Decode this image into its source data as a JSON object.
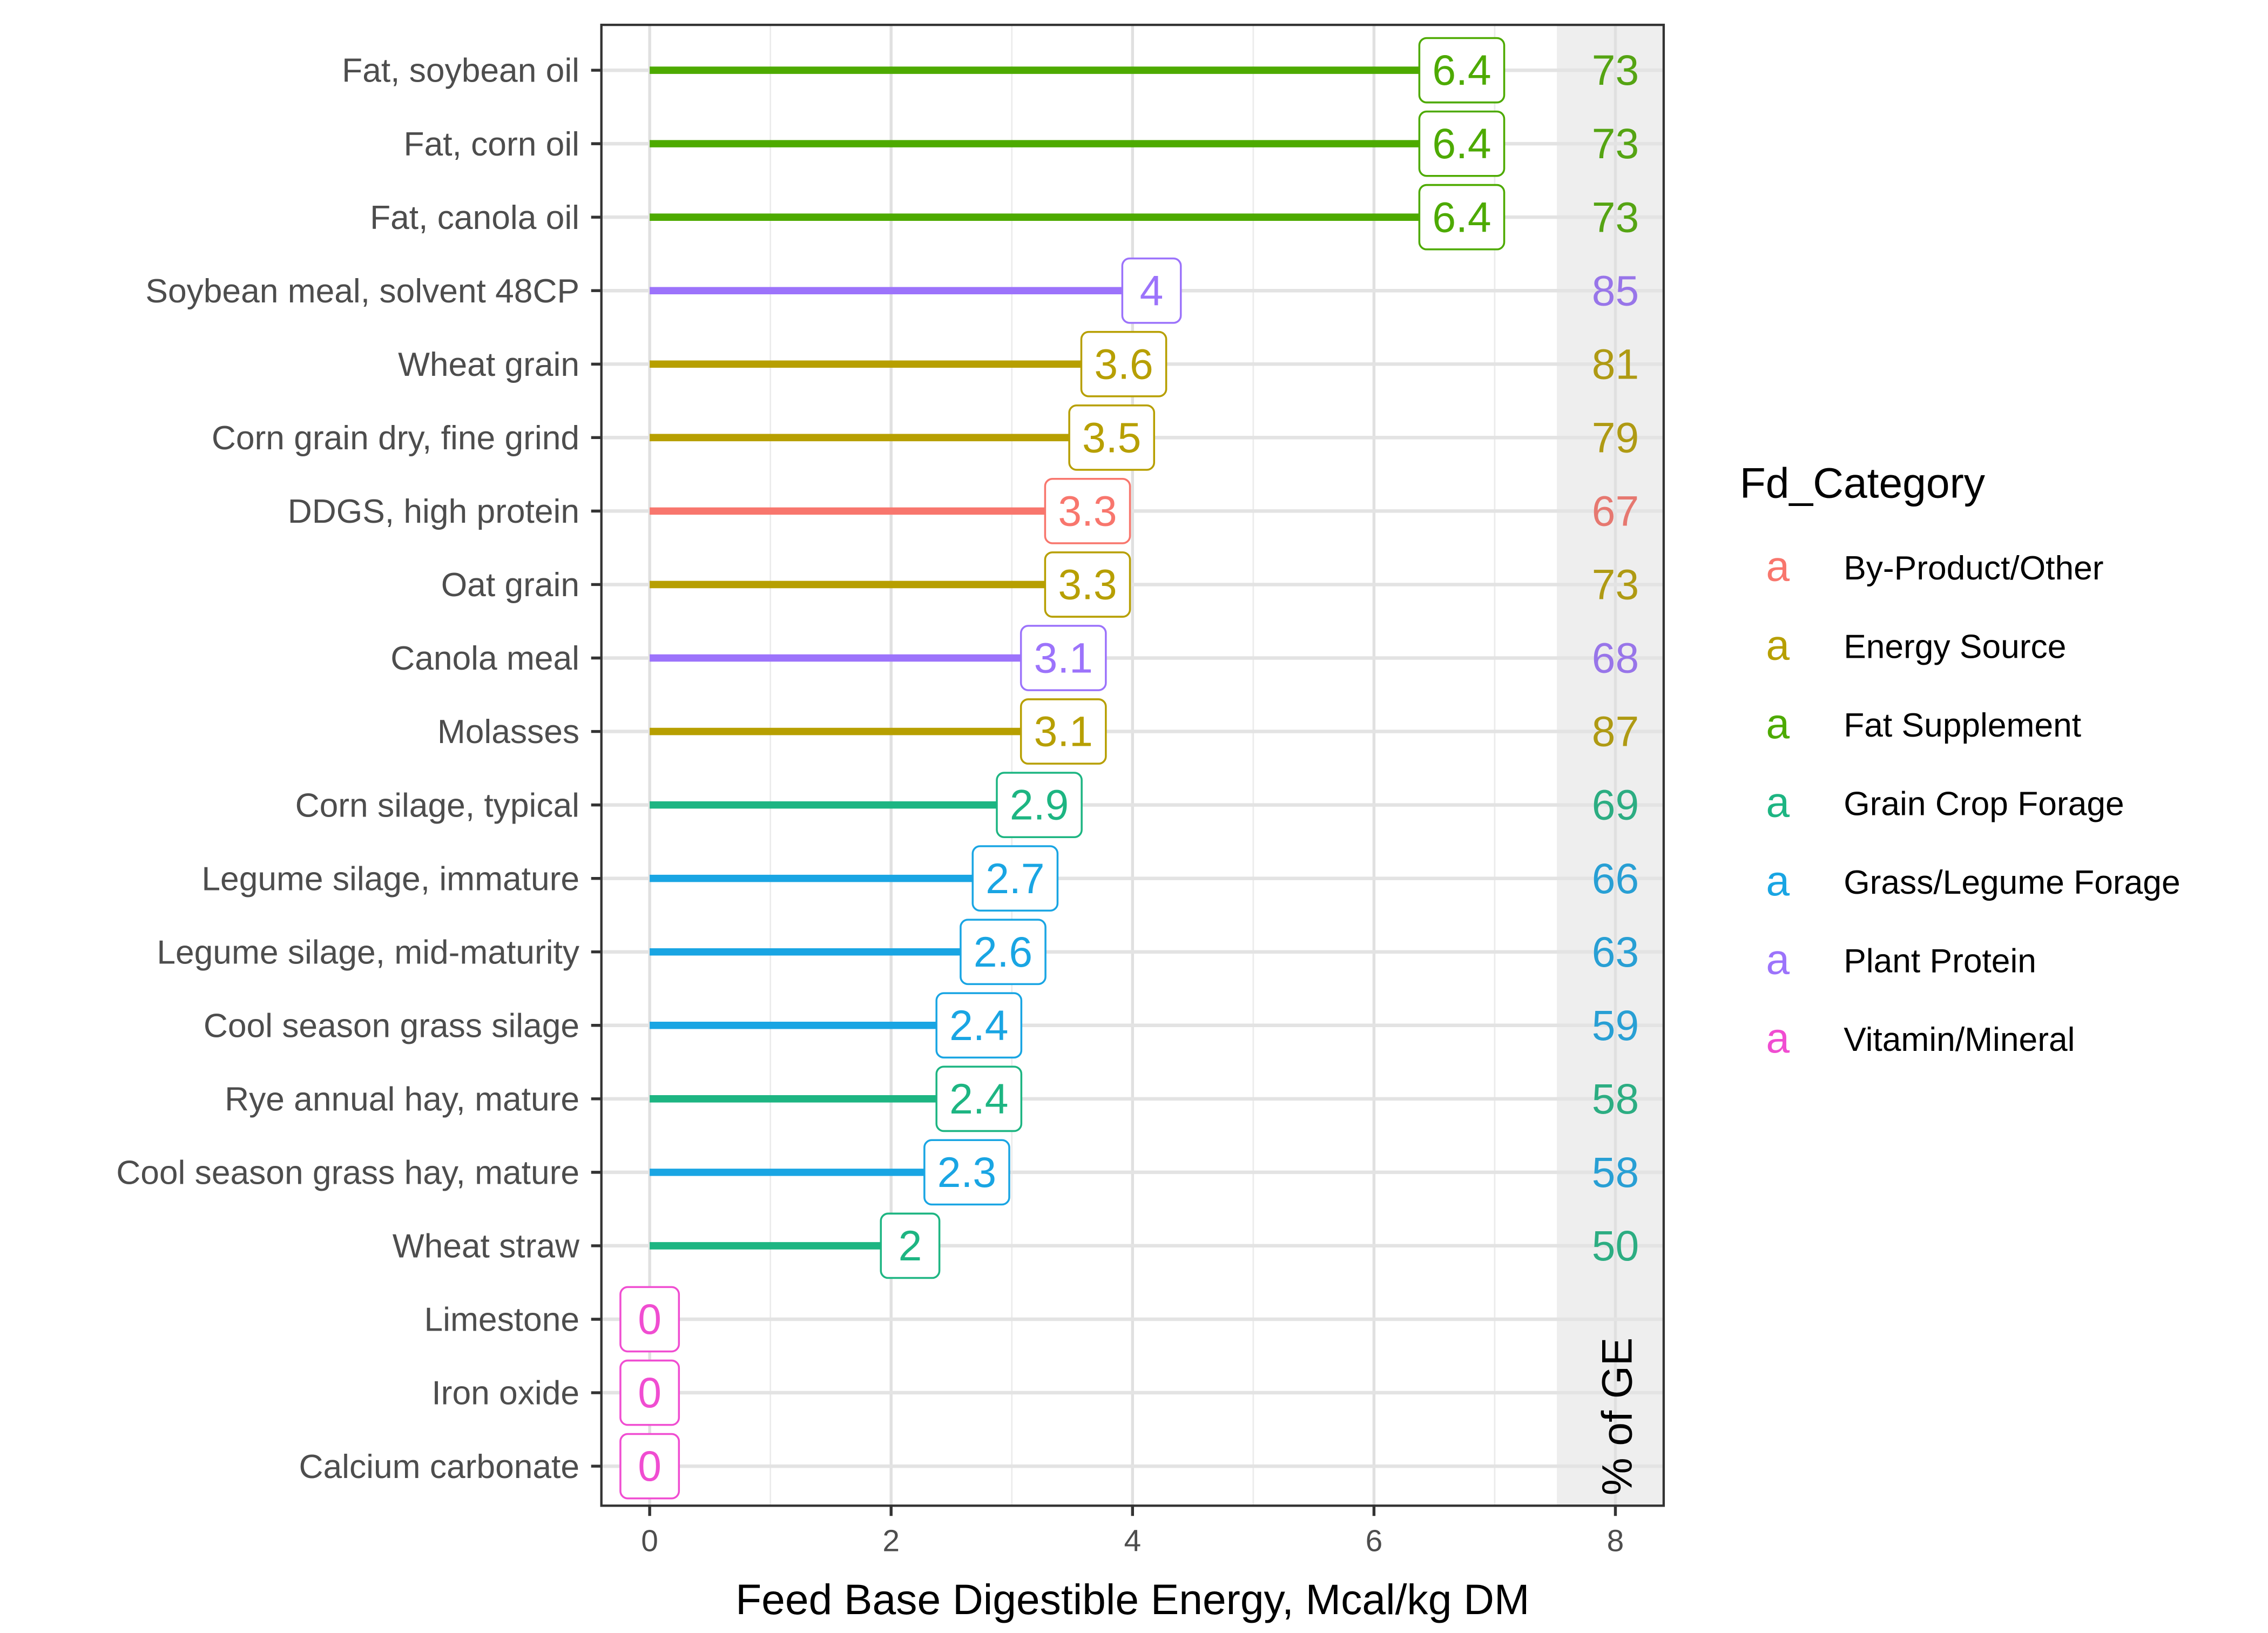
{
  "chart_data": {
    "type": "lollipop-bar",
    "title": "",
    "xlabel": "Feed Base Digestible Energy, Mcal/kg DM",
    "ylabel": "",
    "xlim": [
      -0.4,
      8.4
    ],
    "x_ticks": [
      0,
      2,
      4,
      6,
      8
    ],
    "grid": true,
    "side_annotation_label": "% of GE",
    "legend": {
      "title": "Fd_Category",
      "placement": "right",
      "key_glyph": "a",
      "entries": [
        {
          "name": "By-Product/Other",
          "color": "#F8766D"
        },
        {
          "name": "Energy Source",
          "color": "#B79F00"
        },
        {
          "name": "Fat Supplement",
          "color": "#4DAA00"
        },
        {
          "name": "Grain Crop Forage",
          "color": "#1DB582"
        },
        {
          "name": "Grass/Legume Forage",
          "color": "#19A5E3"
        },
        {
          "name": "Plant Protein",
          "color": "#9C73FB"
        },
        {
          "name": "Vitamin/Mineral",
          "color": "#F04DD1"
        }
      ]
    },
    "series": [
      {
        "feed": "Fat, soybean oil",
        "category": "Fat Supplement",
        "de": 6.4,
        "label": "6.4",
        "pct_ge": 73
      },
      {
        "feed": "Fat, corn oil",
        "category": "Fat Supplement",
        "de": 6.4,
        "label": "6.4",
        "pct_ge": 73
      },
      {
        "feed": "Fat, canola oil",
        "category": "Fat Supplement",
        "de": 6.4,
        "label": "6.4",
        "pct_ge": 73
      },
      {
        "feed": "Soybean meal, solvent 48CP",
        "category": "Plant Protein",
        "de": 4.0,
        "label": "4",
        "pct_ge": 85
      },
      {
        "feed": "Wheat grain",
        "category": "Energy Source",
        "de": 3.6,
        "label": "3.6",
        "pct_ge": 81
      },
      {
        "feed": "Corn grain dry, fine grind",
        "category": "Energy Source",
        "de": 3.5,
        "label": "3.5",
        "pct_ge": 79
      },
      {
        "feed": "DDGS, high protein",
        "category": "By-Product/Other",
        "de": 3.3,
        "label": "3.3",
        "pct_ge": 67
      },
      {
        "feed": "Oat grain",
        "category": "Energy Source",
        "de": 3.3,
        "label": "3.3",
        "pct_ge": 73
      },
      {
        "feed": "Canola meal",
        "category": "Plant Protein",
        "de": 3.1,
        "label": "3.1",
        "pct_ge": 68
      },
      {
        "feed": "Molasses",
        "category": "Energy Source",
        "de": 3.1,
        "label": "3.1",
        "pct_ge": 87
      },
      {
        "feed": "Corn silage, typical",
        "category": "Grain Crop Forage",
        "de": 2.9,
        "label": "2.9",
        "pct_ge": 69
      },
      {
        "feed": "Legume silage, immature",
        "category": "Grass/Legume Forage",
        "de": 2.7,
        "label": "2.7",
        "pct_ge": 66
      },
      {
        "feed": "Legume silage, mid-maturity",
        "category": "Grass/Legume Forage",
        "de": 2.6,
        "label": "2.6",
        "pct_ge": 63
      },
      {
        "feed": "Cool season grass silage",
        "category": "Grass/Legume Forage",
        "de": 2.4,
        "label": "2.4",
        "pct_ge": 59
      },
      {
        "feed": "Rye annual hay, mature",
        "category": "Grain Crop Forage",
        "de": 2.4,
        "label": "2.4",
        "pct_ge": 58
      },
      {
        "feed": "Cool season grass hay, mature",
        "category": "Grass/Legume Forage",
        "de": 2.3,
        "label": "2.3",
        "pct_ge": 58
      },
      {
        "feed": "Wheat straw",
        "category": "Grain Crop Forage",
        "de": 2.0,
        "label": "2",
        "pct_ge": 50
      },
      {
        "feed": "Limestone",
        "category": "Vitamin/Mineral",
        "de": 0,
        "label": "0",
        "pct_ge": null
      },
      {
        "feed": "Iron oxide",
        "category": "Vitamin/Mineral",
        "de": 0,
        "label": "0",
        "pct_ge": null
      },
      {
        "feed": "Calcium carbonate",
        "category": "Vitamin/Mineral",
        "de": 0,
        "label": "0",
        "pct_ge": null
      }
    ]
  }
}
